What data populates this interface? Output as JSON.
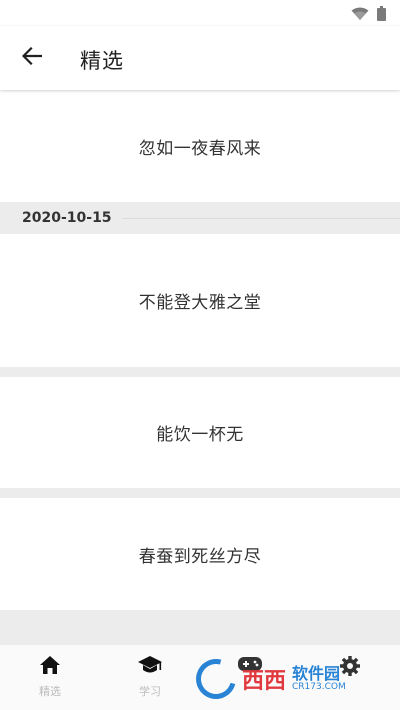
{
  "status_bar": {
    "wifi_icon": "wifi-icon",
    "battery_icon": "battery-icon"
  },
  "header": {
    "title": "精选",
    "back_icon": "arrow-left-icon"
  },
  "feed": {
    "first_card": "忽如一夜春风来",
    "date": "2020-10-15",
    "cards": [
      "不能登大雅之堂",
      "能饮一杯无",
      "春蚕到死丝方尽"
    ]
  },
  "bottom_nav": {
    "items": [
      {
        "icon": "home-icon",
        "label": "精选"
      },
      {
        "icon": "graduation-cap-icon",
        "label": "学习"
      },
      {
        "icon": "gamepad-icon",
        "label": ""
      },
      {
        "icon": "gear-icon",
        "label": ""
      }
    ]
  },
  "watermark": {
    "brand": "西西",
    "text": "软件园",
    "domain": "CR173.COM"
  },
  "colors": {
    "app_bar": "#ffffff",
    "background": "#ececec",
    "watermark_red": "#e0393e",
    "watermark_blue": "#2a84d6"
  }
}
